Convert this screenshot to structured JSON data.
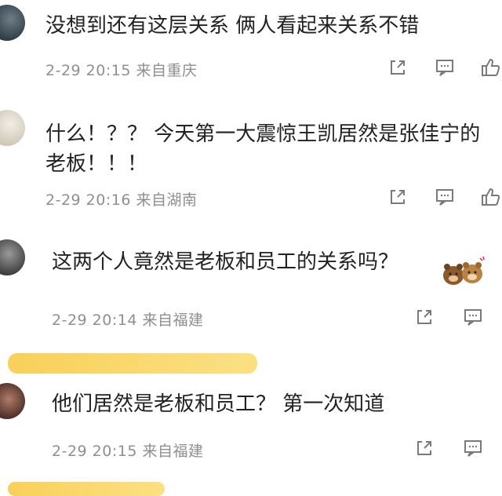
{
  "comments": [
    {
      "text": "没想到还有这层关系 俩人看起来关系不错",
      "meta": "2-29 20:15  来自重庆"
    },
    {
      "text": "什么！？？ 今天第一大震惊王凯居然是张佳宁的\n老板！！！",
      "meta": "2-29 20:16  来自湖南"
    },
    {
      "text": "这两个人竟然是老板和员工的关系吗？",
      "meta": "2-29 20:14  来自福建"
    },
    {
      "text": "他们居然是老板和员工？ 第一次知道",
      "meta": "2-29 20:15  来自福建"
    }
  ],
  "colors": {
    "text": "#222222",
    "meta": "#8f8f8f",
    "icon": "#7a7a7a",
    "highlight": "#f7c83c"
  },
  "icons": [
    "share-icon",
    "comment-icon",
    "like-icon",
    "sticker-bear-icon"
  ]
}
